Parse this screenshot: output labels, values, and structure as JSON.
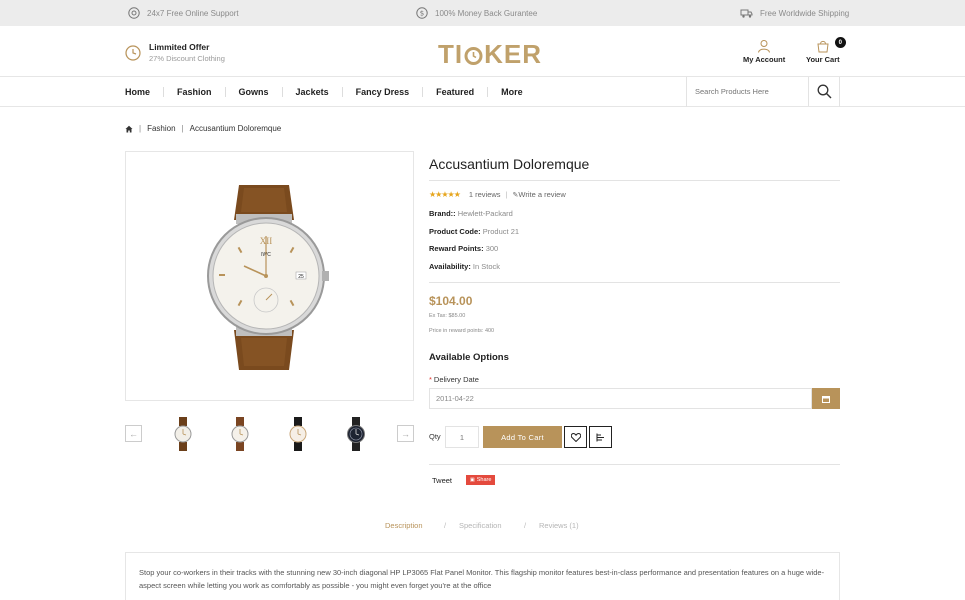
{
  "topbar": {
    "support": "24x7 Free Online Support",
    "money_back": "100% Money Back Gurantee",
    "shipping": "Free Worldwide Shipping",
    "icons": [
      "support-icon",
      "dollar-icon",
      "truck-icon"
    ]
  },
  "header": {
    "offer_title": "Limmited Offer",
    "offer_sub": "27% Discount Clothing",
    "logo_pre": "TI",
    "logo_post": "KER",
    "account_label": "My Account",
    "cart_label": "Your Cart",
    "cart_count": "0"
  },
  "nav": {
    "items": [
      "Home",
      "Fashion",
      "Gowns",
      "Jackets",
      "Fancy Dress",
      "Featured",
      "More"
    ],
    "search_placeholder": "Search Products Here"
  },
  "breadcrumb": {
    "items": [
      "Fashion",
      "Accusantium Doloremque"
    ]
  },
  "product": {
    "title": "Accusantium Doloremque",
    "reviews": "1 reviews",
    "write_review": "Write a review",
    "rating": 5,
    "brand_label": "Brand::",
    "brand_value": "Hewlett-Packard",
    "code_label": "Product Code:",
    "code_value": "Product 21",
    "points_label": "Reward Points:",
    "points_value": "300",
    "avail_label": "Availability:",
    "avail_value": "In Stock",
    "price": "$104.00",
    "ex_tax": "Ex Tax: $85.00",
    "reward_price": "Price in reward points: 400",
    "options_title": "Available Options",
    "delivery_label": "Delivery Date",
    "delivery_value": "2011-04-22",
    "qty_label": "Qty",
    "qty_value": "1",
    "add_to_cart": "Add To Cart",
    "tweet": "Tweet",
    "share": "Share",
    "accent": "#b8935a"
  },
  "tabs": {
    "items": [
      "Description",
      "Specification",
      "Reviews (1)"
    ],
    "active": 0
  },
  "description": {
    "text": "Stop your co-workers in their tracks with the stunning new 30-inch diagonal HP LP3065 Flat Panel Monitor. This flagship monitor features best-in-class performance and presentation features on a huge wide-aspect screen while letting you work as comfortably as possible - you might even forget you're at the office"
  }
}
